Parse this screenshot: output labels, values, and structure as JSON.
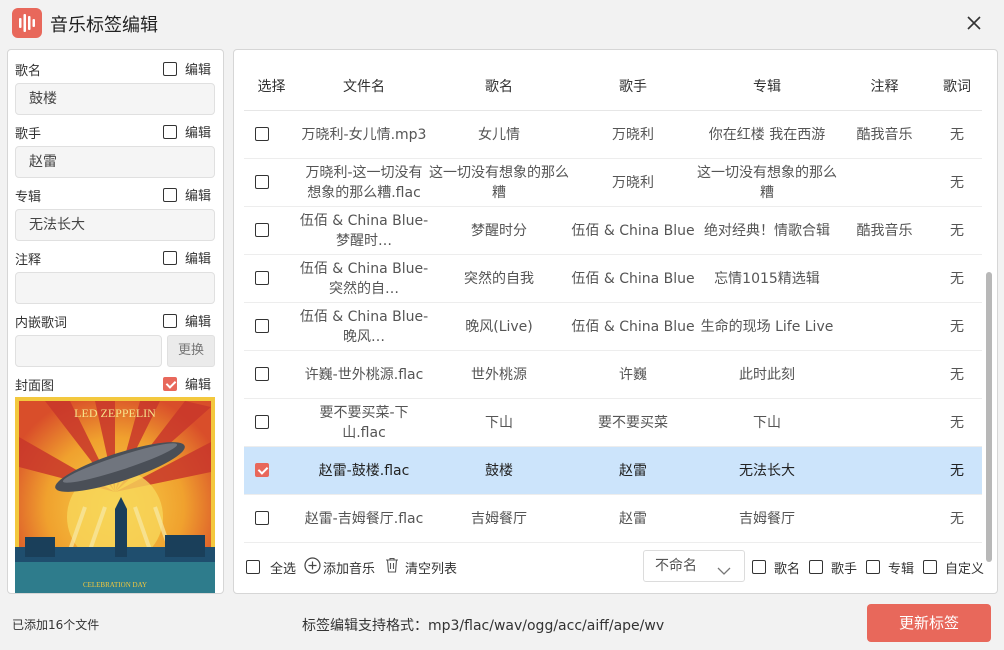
{
  "app": {
    "title": "音乐标签编辑"
  },
  "left": {
    "fields": [
      {
        "label": "歌名",
        "value": "鼓楼",
        "edit_label": "编辑",
        "edit_checked": false
      },
      {
        "label": "歌手",
        "value": "赵雷",
        "edit_label": "编辑",
        "edit_checked": false
      },
      {
        "label": "专辑",
        "value": "无法长大",
        "edit_label": "编辑",
        "edit_checked": false
      },
      {
        "label": "注释",
        "value": "",
        "edit_label": "编辑",
        "edit_checked": false
      },
      {
        "label": "内嵌歌词",
        "value": "",
        "edit_label": "编辑",
        "edit_checked": false
      }
    ],
    "replace_label": "更换",
    "cover": {
      "label": "封面图",
      "edit_label": "编辑",
      "edit_checked": true,
      "logo_text": "LED ZEPPELIN",
      "caption_text": "CELEBRATION DAY"
    }
  },
  "table": {
    "columns": [
      "选择",
      "文件名",
      "歌名",
      "歌手",
      "专辑",
      "注释",
      "歌词"
    ],
    "rows": [
      {
        "checked": false,
        "file": "万晓利-女儿情.mp3",
        "title": "女儿情",
        "artist": "万晓利",
        "album": "你在红楼 我在西游",
        "comment": "酷我音乐",
        "lyrics": "无"
      },
      {
        "checked": false,
        "file": "万晓利-这一切没有想象的那么糟.flac",
        "title": "这一切没有想象的那么糟",
        "artist": "万晓利",
        "album": "这一切没有想象的那么糟",
        "comment": "",
        "lyrics": "无"
      },
      {
        "checked": false,
        "file": "伍佰 & China Blue-梦醒时…",
        "title": "梦醒时分",
        "artist": "伍佰 & China Blue",
        "album": "绝对经典！情歌合辑",
        "comment": "酷我音乐",
        "lyrics": "无"
      },
      {
        "checked": false,
        "file": "伍佰 & China Blue-突然的自…",
        "title": "突然的自我",
        "artist": "伍佰 & China Blue",
        "album": "忘情1015精选辑",
        "comment": "",
        "lyrics": "无"
      },
      {
        "checked": false,
        "file": "伍佰 & China Blue-晚风…",
        "title": "晚风(Live)",
        "artist": "伍佰 & China Blue",
        "album": "生命的现场 Life Live",
        "comment": "",
        "lyrics": "无"
      },
      {
        "checked": false,
        "file": "许巍-世外桃源.flac",
        "title": "世外桃源",
        "artist": "许巍",
        "album": "此时此刻",
        "comment": "",
        "lyrics": "无"
      },
      {
        "checked": false,
        "file": "要不要买菜-下山.flac",
        "title": "下山",
        "artist": "要不要买菜",
        "album": "下山",
        "comment": "",
        "lyrics": "无"
      },
      {
        "checked": true,
        "file": "赵雷-鼓楼.flac",
        "title": "鼓楼",
        "artist": "赵雷",
        "album": "无法长大",
        "comment": "",
        "lyrics": "无"
      },
      {
        "checked": false,
        "file": "赵雷-吉姆餐厅.flac",
        "title": "吉姆餐厅",
        "artist": "赵雷",
        "album": "吉姆餐厅",
        "comment": "",
        "lyrics": "无"
      }
    ]
  },
  "toolbar": {
    "select_all": "全选",
    "add_music": "添加音乐",
    "clear_list": "清空列表",
    "rename_option": "不命名",
    "opt_title": "歌名",
    "opt_artist": "歌手",
    "opt_album": "专辑",
    "opt_custom": "自定义"
  },
  "footer": {
    "count_text": "已添加16个文件",
    "formats_text": "标签编辑支持格式：mp3/flac/wav/ogg/acc/aiff/ape/wv",
    "update_button": "更新标签"
  },
  "colors": {
    "accent": "#e8685b",
    "selected_row": "#cce4fb"
  }
}
